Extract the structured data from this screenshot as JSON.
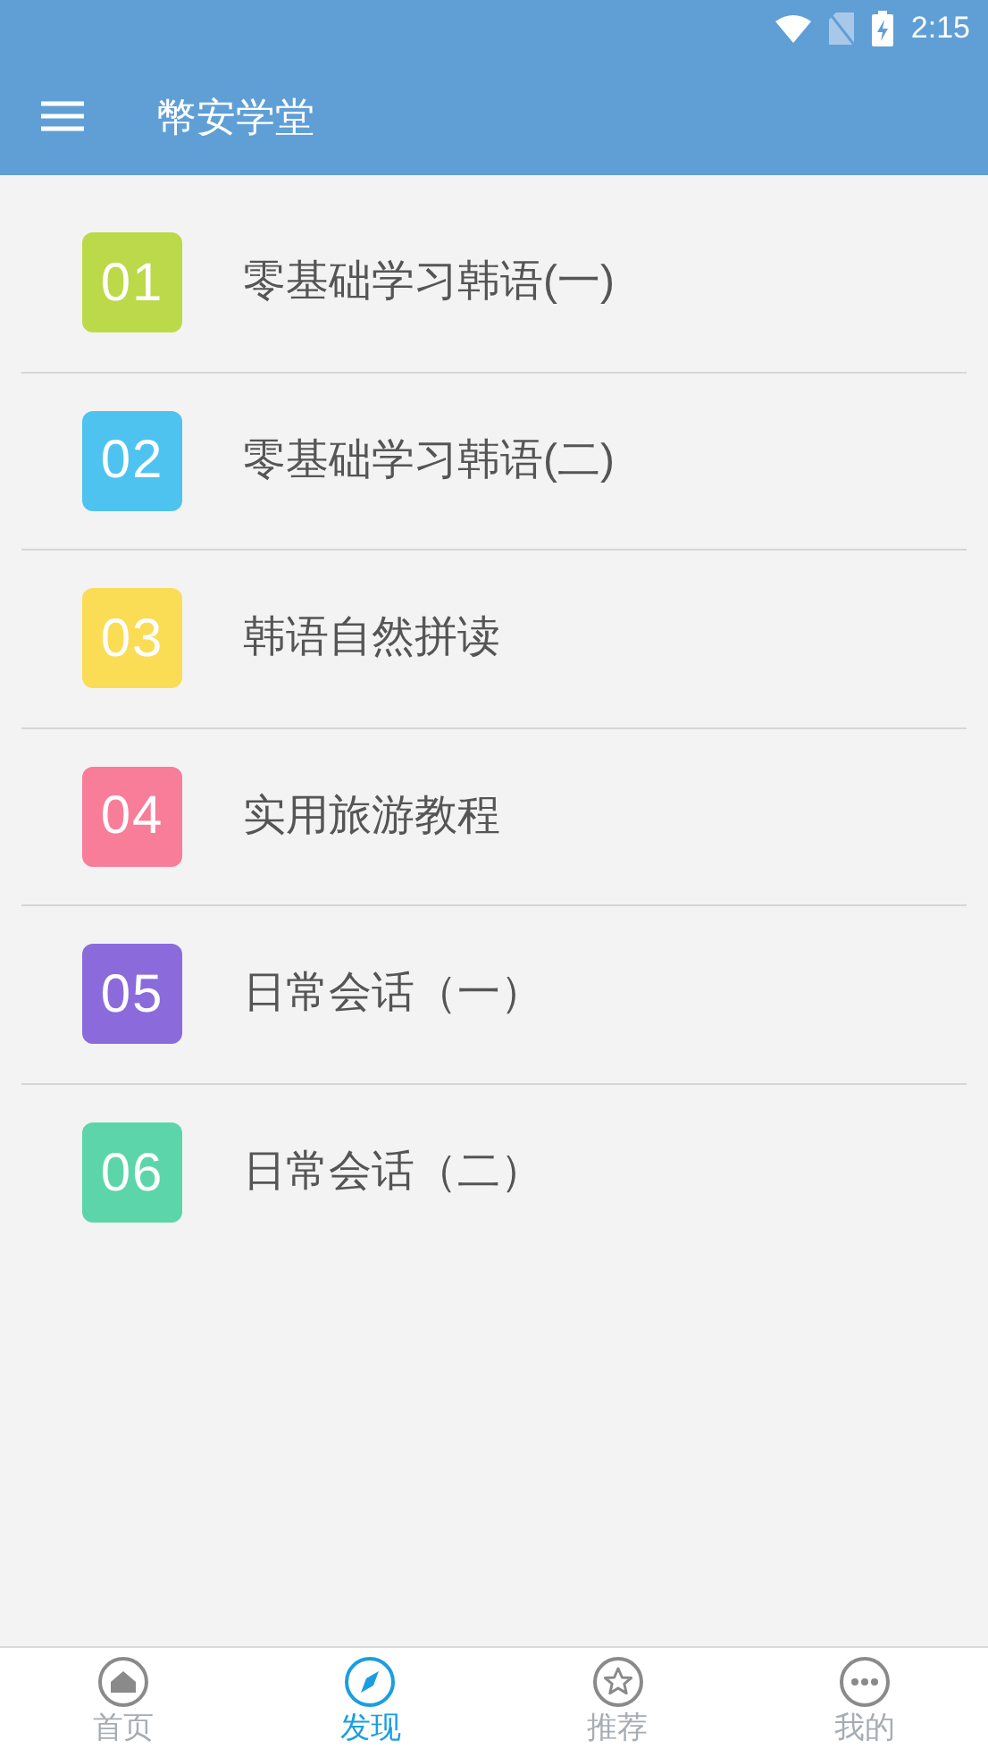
{
  "status_bar": {
    "time": "2:15"
  },
  "app_bar": {
    "title": "幣安学堂"
  },
  "courses": [
    {
      "number": "01",
      "title": "零基础学习韩语(一)",
      "color": "#bcd94a"
    },
    {
      "number": "02",
      "title": "零基础学习韩语(二)",
      "color": "#4ec3f0"
    },
    {
      "number": "03",
      "title": "韩语自然拼读",
      "color": "#fbdc55"
    },
    {
      "number": "04",
      "title": "实用旅游教程",
      "color": "#f77d99"
    },
    {
      "number": "05",
      "title": "日常会话（一）",
      "color": "#8b6bdc"
    },
    {
      "number": "06",
      "title": "日常会话（二）",
      "color": "#5dd5aa"
    }
  ],
  "bottom_nav": [
    {
      "kind": "home",
      "label": "首页",
      "selected": false
    },
    {
      "kind": "compass",
      "label": "发现",
      "selected": true
    },
    {
      "kind": "star",
      "label": "推荐",
      "selected": false
    },
    {
      "kind": "more",
      "label": "我的",
      "selected": false
    }
  ]
}
